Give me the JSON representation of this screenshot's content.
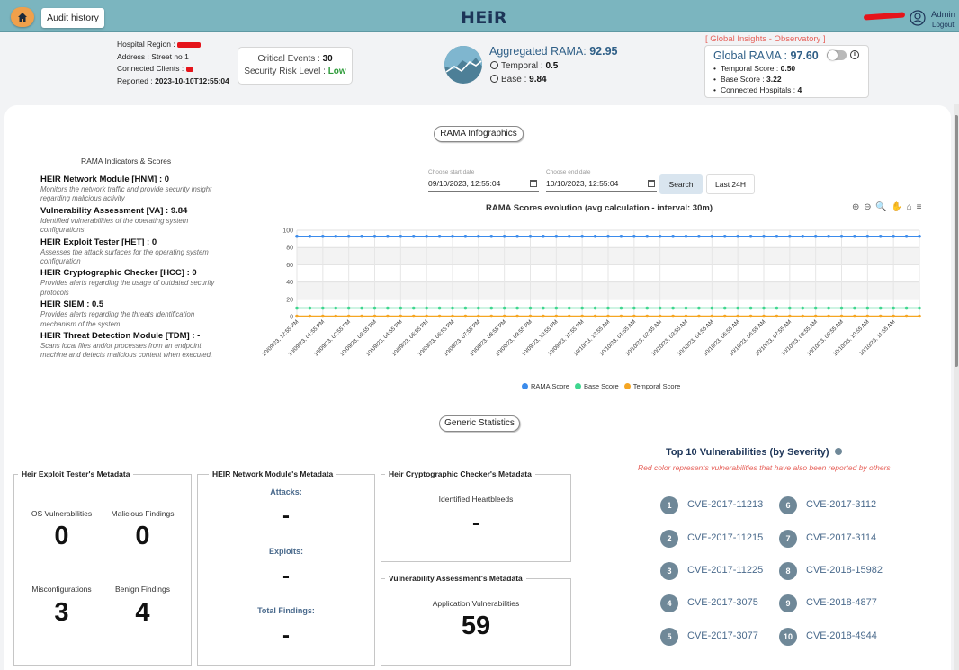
{
  "header": {
    "audit_label": "Audit history",
    "brand": "HEiR",
    "admin_label": "Admin",
    "logout_label": "Logout"
  },
  "hospital": {
    "region_label": "Hospital Region :",
    "address_label": "Address :",
    "address_value": "Street no 1",
    "clients_label": "Connected Clients :",
    "reported_label": "Reported :",
    "reported_value": "2023-10-10T12:55:04"
  },
  "events": {
    "critical_label": "Critical Events :",
    "critical_value": "30",
    "risk_label": "Security Risk Level :",
    "risk_value": "Low"
  },
  "aggregated": {
    "title": "Aggregated RAMA:",
    "value": "92.95",
    "temporal_label": "Temporal :",
    "temporal_value": "0.5",
    "base_label": "Base :",
    "base_value": "9.84"
  },
  "global": {
    "header": "[ Global Insights - Observatory ]",
    "title": "Global RAMA :",
    "value": "97.60",
    "items": [
      {
        "label": "Temporal Score :",
        "value": "0.50"
      },
      {
        "label": "Base Score :",
        "value": "3.22"
      },
      {
        "label": "Connected Hospitals :",
        "value": "4"
      }
    ]
  },
  "infographics_label": "RAMA Infographics",
  "indicators": {
    "title": "RAMA Indicators & Scores",
    "items": [
      {
        "name": "HEIR Network Module [HNM] : 0",
        "desc": "Monitors the network traffic and provide security insight regarding malicious activity"
      },
      {
        "name": "Vulnerability Assessment [VA] : 9.84",
        "desc": "Identified vulnerabilities of the operating system configurations"
      },
      {
        "name": "HEIR Exploit Tester [HET] : 0",
        "desc": "Assesses the attack surfaces for the operating system configuration"
      },
      {
        "name": "HEIR Cryptographic Checker [HCC] : 0",
        "desc": "Provides alerts regarding the usage of outdated security protocols"
      },
      {
        "name": "HEIR SIEM : 0.5",
        "desc": "Provides alerts regarding the threats identification mechanism of the system"
      },
      {
        "name": "HEIR Threat Detection Module [TDM] : -",
        "desc": "Scans local files and/or processes from an endpoint machine and detects malicious content when executed."
      }
    ]
  },
  "filters": {
    "start_label": "Choose start date",
    "start_value": "09/10/2023, 12:55:04",
    "end_label": "Choose end date",
    "end_value": "10/10/2023, 12:55:04",
    "search_label": "Search",
    "last24_label": "Last 24H"
  },
  "chart_tools": "⊕ ⊖ 🔍 ✋ ⌂ ≡",
  "chart_data": {
    "type": "line",
    "title": "RAMA Scores evolution (avg calculation - interval: 30m)",
    "ylim": [
      0,
      100
    ],
    "yticks": [
      0,
      20,
      40,
      60,
      80,
      100
    ],
    "x": [
      "10/09/23, 12:55 PM",
      "10/09/23, 01:55 PM",
      "10/09/23, 02:55 PM",
      "10/09/23, 03:55 PM",
      "10/09/23, 04:55 PM",
      "10/09/23, 05:55 PM",
      "10/09/23, 06:55 PM",
      "10/09/23, 07:55 PM",
      "10/09/23, 08:55 PM",
      "10/09/23, 09:55 PM",
      "10/09/23, 10:55 PM",
      "10/09/23, 11:55 PM",
      "10/10/23, 12:55 AM",
      "10/10/23, 01:55 AM",
      "10/10/23, 02:55 AM",
      "10/10/23, 03:55 AM",
      "10/10/23, 04:55 AM",
      "10/10/23, 05:55 AM",
      "10/10/23, 06:55 AM",
      "10/10/23, 07:55 AM",
      "10/10/23, 08:55 AM",
      "10/10/23, 09:55 AM",
      "10/10/23, 10:55 AM",
      "10/10/23, 11:55 AM"
    ],
    "series": [
      {
        "name": "RAMA Score",
        "color": "#3b8beb",
        "value": 92.95
      },
      {
        "name": "Base Score",
        "color": "#3fd68f",
        "value": 9.84
      },
      {
        "name": "Temporal Score",
        "color": "#f5a623",
        "value": 0.5
      }
    ],
    "points_per_hour": 2,
    "grid": true,
    "legend": "bottom"
  },
  "generic_label": "Generic Statistics",
  "exploit_meta": {
    "title": "Heir Exploit Tester's Metadata",
    "os_label": "OS Vulnerabilities",
    "os_value": "0",
    "mal_label": "Malicious Findings",
    "mal_value": "0",
    "misc_label": "Misconfigurations",
    "misc_value": "3",
    "benign_label": "Benign Findings",
    "benign_value": "4"
  },
  "network_meta": {
    "title": "HEIR Network Module's Metadata",
    "attacks_label": "Attacks:",
    "attacks_value": "-",
    "exploits_label": "Exploits:",
    "exploits_value": "-",
    "total_label": "Total Findings:",
    "total_value": "-"
  },
  "crypto_meta": {
    "title": "Heir Cryptographic Checker's Metadata",
    "label": "Identified Heartbleeds",
    "value": "-"
  },
  "va_meta": {
    "title": "Vulnerability Assessment's Metadata",
    "label": "Application Vulnerabilities",
    "value": "59"
  },
  "top10": {
    "title": "Top 10 Vulnerabilities (by Severity)",
    "subtitle": "Red color represents vulnerabilities that have also been reported by others",
    "items": [
      {
        "rank": "1",
        "id": "CVE-2017-11213"
      },
      {
        "rank": "2",
        "id": "CVE-2017-11215"
      },
      {
        "rank": "3",
        "id": "CVE-2017-11225"
      },
      {
        "rank": "4",
        "id": "CVE-2017-3075"
      },
      {
        "rank": "5",
        "id": "CVE-2017-3077"
      },
      {
        "rank": "6",
        "id": "CVE-2017-3112"
      },
      {
        "rank": "7",
        "id": "CVE-2017-3114"
      },
      {
        "rank": "8",
        "id": "CVE-2018-15982"
      },
      {
        "rank": "9",
        "id": "CVE-2018-4877"
      },
      {
        "rank": "10",
        "id": "CVE-2018-4944"
      }
    ]
  }
}
